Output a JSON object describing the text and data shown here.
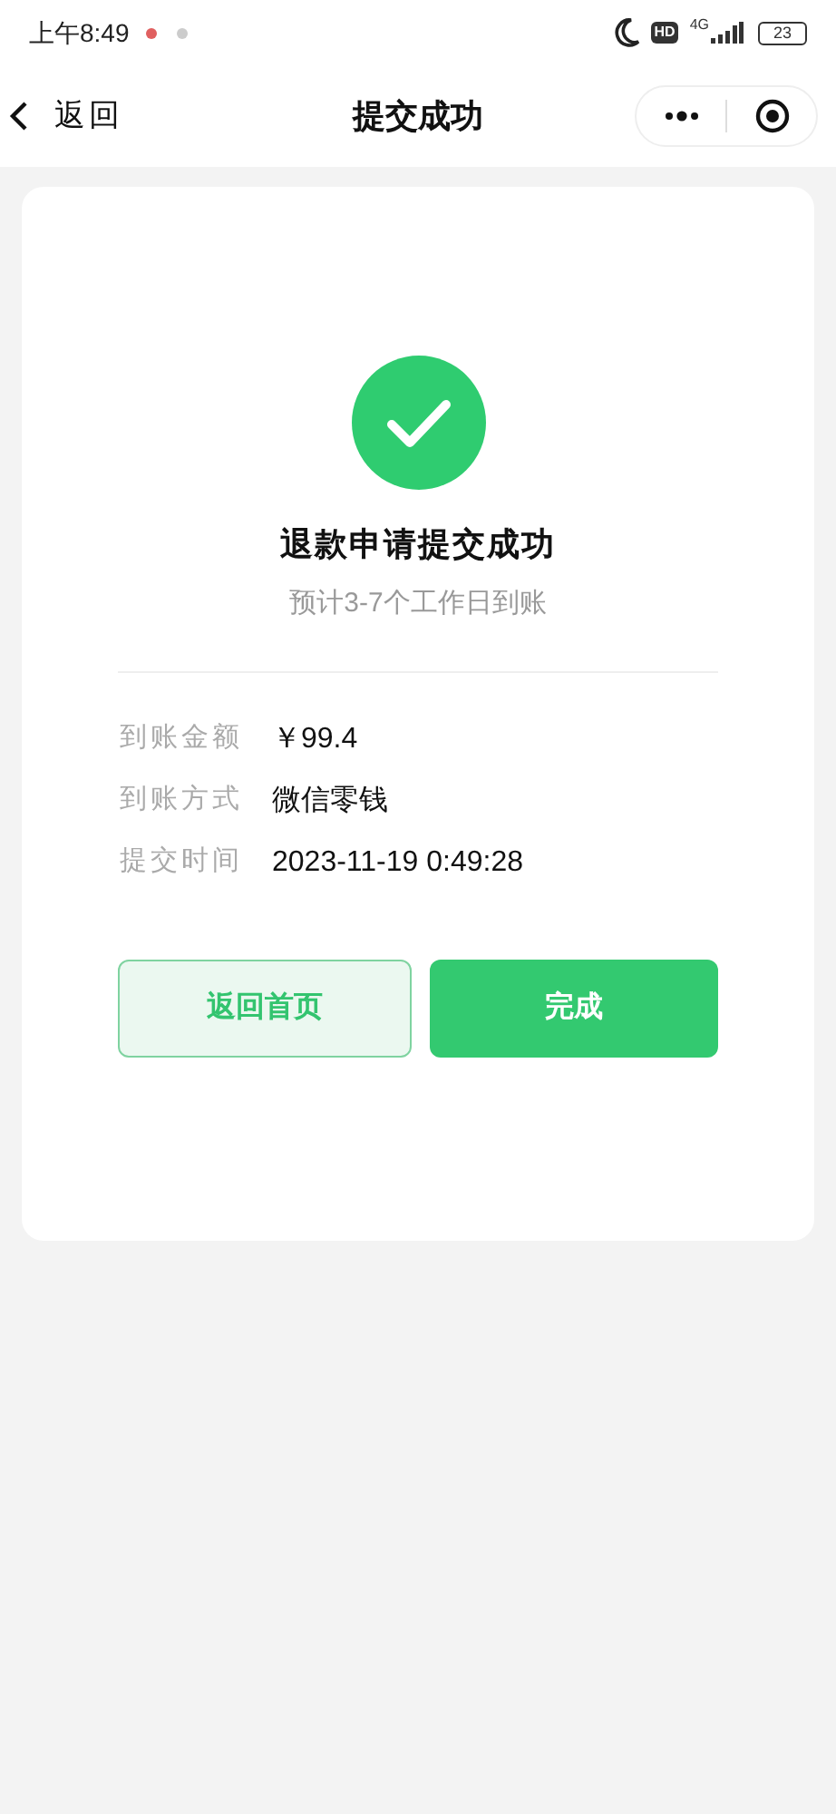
{
  "status_bar": {
    "time": "上午8:49",
    "network": "4G",
    "hd": "HD",
    "battery": "23"
  },
  "nav": {
    "back": "返回",
    "title": "提交成功"
  },
  "result": {
    "title": "退款申请提交成功",
    "subtitle": "预计3-7个工作日到账"
  },
  "details": [
    {
      "label": "到账金额",
      "value": "￥99.4"
    },
    {
      "label": "到账方式",
      "value": "微信零钱"
    },
    {
      "label": "提交时间",
      "value": "2023-11-19 0:49:28"
    }
  ],
  "buttons": [
    {
      "kind": "outline",
      "label": "返回首页"
    },
    {
      "kind": "primary",
      "label": "完成"
    }
  ]
}
